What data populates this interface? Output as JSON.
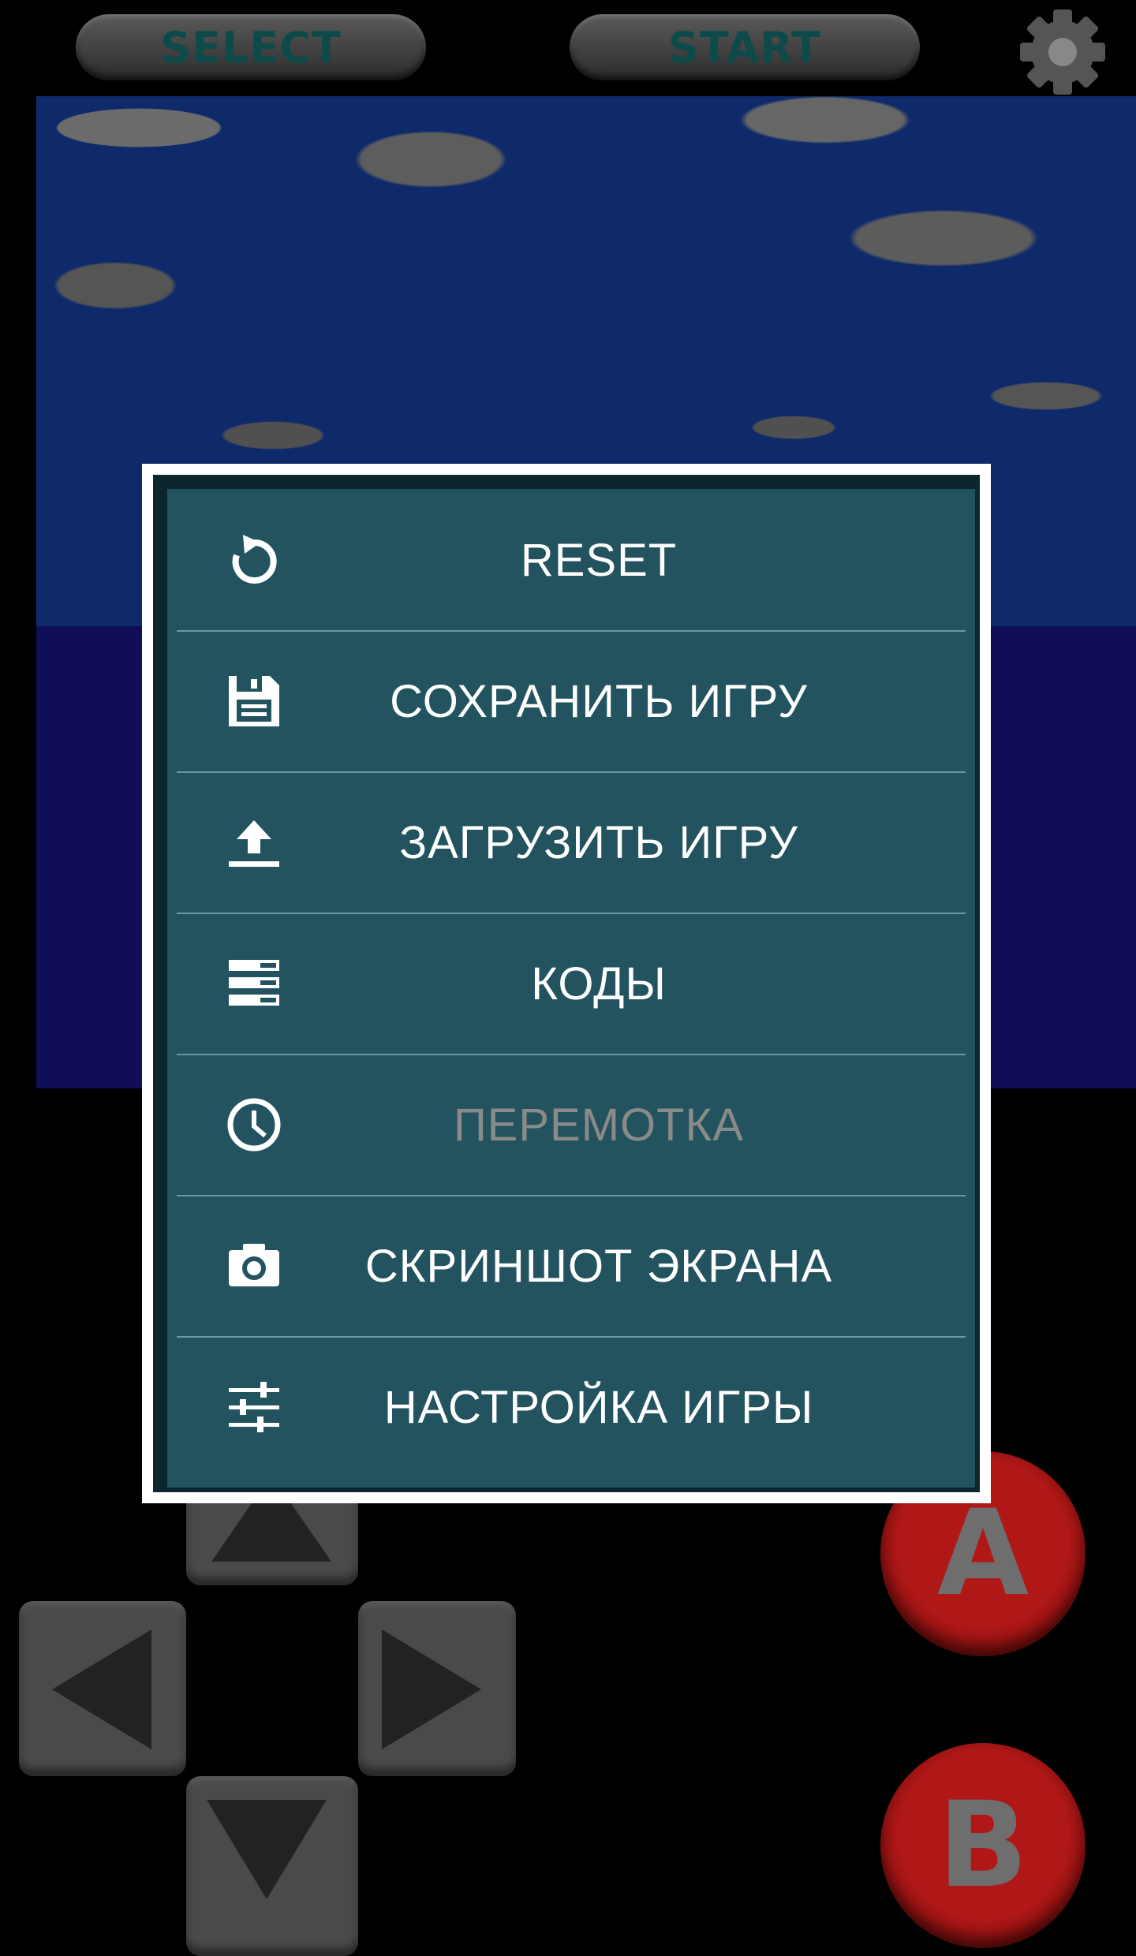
{
  "topbar": {
    "select_label": "SELECT",
    "start_label": "START",
    "settings_icon": "gear-icon"
  },
  "menu": {
    "items": [
      {
        "label": "RESET",
        "icon": "reset-icon",
        "enabled": true
      },
      {
        "label": "СОХРАНИТЬ ИГРУ",
        "icon": "save-icon",
        "enabled": true
      },
      {
        "label": "ЗАГРУЗИТЬ ИГРУ",
        "icon": "upload-icon",
        "enabled": true
      },
      {
        "label": "КОДЫ",
        "icon": "list-icon",
        "enabled": true
      },
      {
        "label": "ПЕРЕМОТКА",
        "icon": "clock-icon",
        "enabled": false
      },
      {
        "label": "СКРИНШОТ ЭКРАНА",
        "icon": "camera-icon",
        "enabled": true
      },
      {
        "label": "НАСТРОЙКА ИГРЫ",
        "icon": "sliders-icon",
        "enabled": true
      }
    ]
  },
  "gamepad": {
    "a_label": "A",
    "b_label": "B"
  },
  "colors": {
    "dialog_bg": "#22535e",
    "divider": "#6a9aa2",
    "disabled_text": "#8a8a8a",
    "button_red": "#b01818"
  }
}
